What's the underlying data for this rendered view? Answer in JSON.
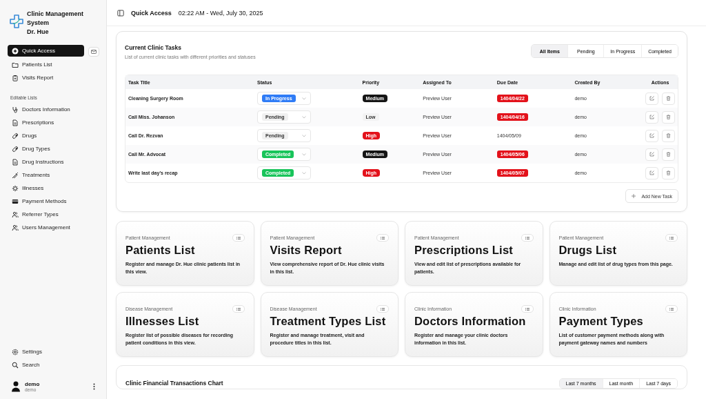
{
  "brand": {
    "title": "Clinic Management System",
    "subtitle": "Dr. Hue"
  },
  "sidebar": {
    "main_items": [
      {
        "label": "Quick Access",
        "selected": true
      },
      {
        "label": "Patients List",
        "selected": false
      },
      {
        "label": "Visits Report",
        "selected": false
      }
    ],
    "section_title": "Editable Lists",
    "list_items": [
      {
        "label": "Doctors Information",
        "selected": false
      },
      {
        "label": "Prescriptions",
        "selected": false
      },
      {
        "label": "Drugs",
        "selected": false
      },
      {
        "label": "Drug Types",
        "selected": false
      },
      {
        "label": "Drug Instructions",
        "selected": false
      },
      {
        "label": "Treatments",
        "selected": false
      },
      {
        "label": "Illnesses",
        "selected": false
      },
      {
        "label": "Payment Methods",
        "selected": false
      },
      {
        "label": "Referrer Types",
        "selected": false
      },
      {
        "label": "Users Management",
        "selected": false
      }
    ],
    "footer_items": [
      {
        "label": "Settings"
      },
      {
        "label": "Search"
      }
    ],
    "user": {
      "name": "demo",
      "role": "demo"
    }
  },
  "topbar": {
    "title": "Quick Access",
    "datetime": "02:22 AM - Wed, July 30, 2025"
  },
  "tasks": {
    "title": "Current Clinic Tasks",
    "description": "List of current clinic tasks with different priorities and statuses",
    "filters": [
      {
        "label": "All Items",
        "selected": true
      },
      {
        "label": "Pending",
        "selected": false
      },
      {
        "label": "In Progress",
        "selected": false
      },
      {
        "label": "Completed",
        "selected": false
      }
    ],
    "columns": [
      "Task Title",
      "Status",
      "Priority",
      "Assigned To",
      "Due Date",
      "Created By",
      "Actions"
    ],
    "rows": [
      {
        "title": "Cleaning Surgery Room",
        "status": {
          "label": "In Progress",
          "kind": "in_progress"
        },
        "priority": {
          "label": "Medium",
          "kind": "medium"
        },
        "assigned_to": "Preview User",
        "due_date": {
          "label": "1404/04/22",
          "overdue": true
        },
        "created_by": "demo"
      },
      {
        "title": "Call Miss. Johanson",
        "status": {
          "label": "Pending",
          "kind": "pending"
        },
        "priority": {
          "label": "Low",
          "kind": "low"
        },
        "assigned_to": "Preview User",
        "due_date": {
          "label": "1404/04/16",
          "overdue": true
        },
        "created_by": "demo"
      },
      {
        "title": "Call Dr. Rezvan",
        "status": {
          "label": "Pending",
          "kind": "pending"
        },
        "priority": {
          "label": "High",
          "kind": "high"
        },
        "assigned_to": "Preview User",
        "due_date": {
          "label": "1404/05/09",
          "overdue": false
        },
        "created_by": "demo"
      },
      {
        "title": "Call Mr. Advocat",
        "status": {
          "label": "Completed",
          "kind": "completed"
        },
        "priority": {
          "label": "Medium",
          "kind": "medium"
        },
        "assigned_to": "Preview User",
        "due_date": {
          "label": "1404/05/06",
          "overdue": true
        },
        "created_by": "demo"
      },
      {
        "title": "Write last day's recap",
        "status": {
          "label": "Completed",
          "kind": "completed"
        },
        "priority": {
          "label": "High",
          "kind": "high"
        },
        "assigned_to": "Preview User",
        "due_date": {
          "label": "1404/05/07",
          "overdue": true
        },
        "created_by": "demo"
      }
    ],
    "add_button": "Add New Task"
  },
  "cards": [
    {
      "category": "Patient Management",
      "title": "Patients List",
      "description": "Register and manage Dr. Hue clinic patients list in this view."
    },
    {
      "category": "Patient Management",
      "title": "Visits Report",
      "description": "View comprehensive report of Dr. Hue clinic visits in this list."
    },
    {
      "category": "Patient Management",
      "title": "Prescriptions List",
      "description": "View and edit list of prescriptions available for patients."
    },
    {
      "category": "Patient Management",
      "title": "Drugs List",
      "description": "Manage and edit list of drug types from this page."
    },
    {
      "category": "Disease Management",
      "title": "Illnesses List",
      "description": "Register list of possible diseases for recording patient conditions in this view."
    },
    {
      "category": "Disease Management",
      "title": "Treatment Types List",
      "description": "Register and manage treatment, visit and procedure titles in this list."
    },
    {
      "category": "Clinic Information",
      "title": "Doctors Information",
      "description": "Register and manage your clinic doctors information in this list."
    },
    {
      "category": "Clinic Information",
      "title": "Payment Types",
      "description": "List of customer payment methods along with payment gateway names and numbers"
    }
  ],
  "chart_card": {
    "title": "Clinic Financial Transactions Chart",
    "ranges": [
      {
        "label": "Last 7 months",
        "selected": true
      },
      {
        "label": "Last month",
        "selected": false
      },
      {
        "label": "Last 7 days",
        "selected": false
      }
    ]
  }
}
